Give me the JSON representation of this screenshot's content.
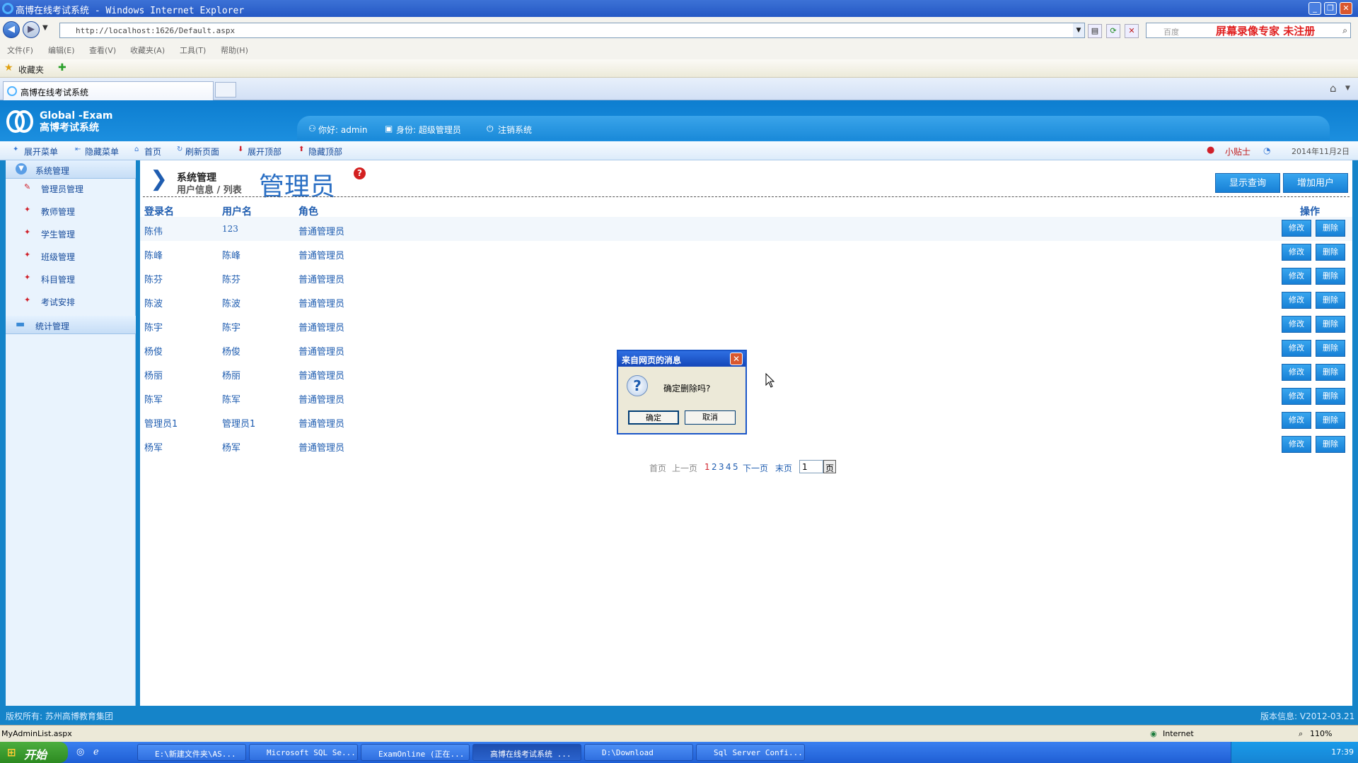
{
  "window": {
    "title": "高博在线考试系统 - Windows Internet Explorer"
  },
  "browser": {
    "url": "http://localhost:1626/Default.aspx",
    "search_placeholder": "百度",
    "watermark": "屏幕录像专家 未注册",
    "menu": [
      "文件(F)",
      "编辑(E)",
      "查看(V)",
      "收藏夹(A)",
      "工具(T)",
      "帮助(H)"
    ],
    "favorites_label": "收藏夹",
    "tab_title": "高博在线考试系统"
  },
  "site": {
    "logo_line1": "Global -Exam",
    "logo_line2": "高博考试系统",
    "greeting": "你好: admin",
    "identity": "身份: 超级管理员",
    "logout": "注销系统"
  },
  "toolbar": {
    "items": [
      "展开菜单",
      "隐藏菜单",
      "首页",
      "刷新页面",
      "展开顶部",
      "隐藏顶部"
    ],
    "tip": "小贴士",
    "date": "2014年11月2日"
  },
  "sidebar": {
    "group1": "系统管理",
    "items": [
      "管理员管理",
      "教师管理",
      "学生管理",
      "班级管理",
      "科目管理",
      "考试安排"
    ],
    "group2": "统计管理"
  },
  "content": {
    "crumb1": "系统管理",
    "crumb2": "用户信息 / 列表",
    "title": "管理员",
    "btn_query": "显示查询",
    "btn_add": "增加用户",
    "headers": {
      "login": "登录名",
      "username": "用户名",
      "role": "角色",
      "ops": "操作"
    },
    "edit_label": "修改",
    "delete_label": "删除",
    "rows": [
      {
        "login": "陈伟",
        "username": "123",
        "role": "普通管理员"
      },
      {
        "login": "陈峰",
        "username": "陈峰",
        "role": "普通管理员"
      },
      {
        "login": "陈芬",
        "username": "陈芬",
        "role": "普通管理员"
      },
      {
        "login": "陈波",
        "username": "陈波",
        "role": "普通管理员"
      },
      {
        "login": "陈宇",
        "username": "陈宇",
        "role": "普通管理员"
      },
      {
        "login": "杨俊",
        "username": "杨俊",
        "role": "普通管理员"
      },
      {
        "login": "杨丽",
        "username": "杨丽",
        "role": "普通管理员"
      },
      {
        "login": "陈军",
        "username": "陈军",
        "role": "普通管理员"
      },
      {
        "login": "管理员1",
        "username": "管理员1",
        "role": "普通管理员"
      },
      {
        "login": "杨军",
        "username": "杨军",
        "role": "普通管理员"
      }
    ],
    "pager": {
      "first": "首页",
      "prev": "上一页",
      "pages": [
        "1",
        "2",
        "3",
        "4",
        "5"
      ],
      "next": "下一页",
      "last": "末页",
      "input_value": "1",
      "go": "页"
    }
  },
  "footer": {
    "copyright": "版权所有: 苏州高博教育集团",
    "version": "版本信息: V2012-03.21"
  },
  "dialog": {
    "title": "来自网页的消息",
    "message": "确定删除吗?",
    "ok": "确定",
    "cancel": "取消"
  },
  "statusbar": {
    "url": "MyAdminList.aspx",
    "zone": "Internet",
    "zoom": "110%"
  },
  "taskbar": {
    "start": "开始",
    "items": [
      "E:\\新建文件夹\\AS...",
      "Microsoft SQL Se...",
      "ExamOnline (正在...",
      "高博在线考试系统 ...",
      "D:\\Download",
      "Sql Server Confi..."
    ],
    "clock": "17:39"
  },
  "colors": {
    "header_blue": "#1584c9",
    "link_blue": "#1f5db0",
    "button_blue": "#1780d6",
    "pin_red": "#d0202a"
  }
}
